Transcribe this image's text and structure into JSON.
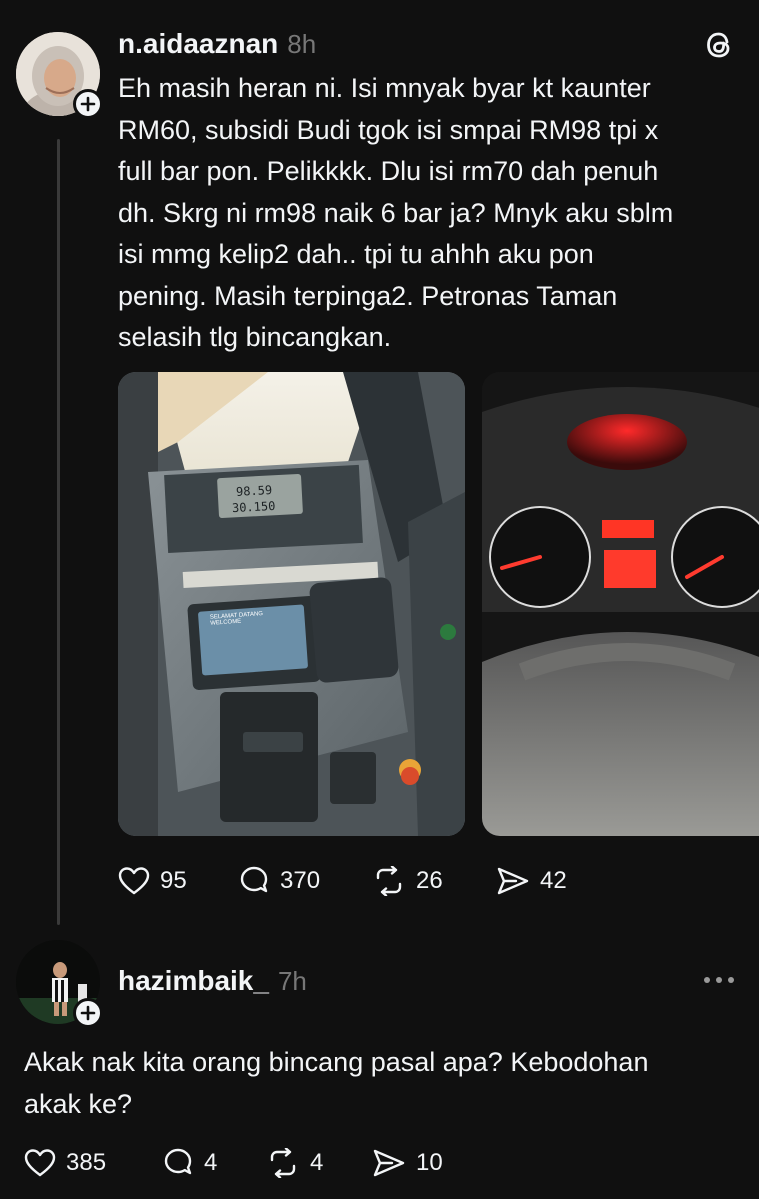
{
  "post": {
    "username": "n.aidaaznan",
    "time": "8h",
    "text": "Eh masih heran ni. Isi mnyak byar kt kaunter\nRM60, subsidi Budi tgok isi smpai RM98 tpi x\nfull bar pon. Pelikkkk. Dlu isi rm70 dah penuh\ndh. Skrg ni rm98 naik 6 bar ja? Mnyk aku sblm\nisi mmg kelip2 dah.. tpi tu ahhh aku pon\npening. Masih terpinga2. Petronas Taman\nselasih tlg bincangkan.",
    "pump": {
      "amount": "98.59",
      "litres": "30.150",
      "screen_banner": "SELAMAT DATANG WELCOME"
    },
    "likes": "95",
    "replies": "370",
    "reposts": "26",
    "shares": "42"
  },
  "reply": {
    "username": "hazimbaik_",
    "time": "7h",
    "text": "Akak nak kita orang bincang pasal apa? Kebodohan\nakak ke?",
    "likes": "385",
    "replies": "4",
    "reposts": "4",
    "shares": "10"
  },
  "icons": {
    "app_logo": "threads-logo-icon",
    "like": "heart-icon",
    "reply": "comment-icon",
    "repost": "repost-icon",
    "share": "share-icon",
    "more": "more-icon",
    "follow": "plus-icon"
  }
}
